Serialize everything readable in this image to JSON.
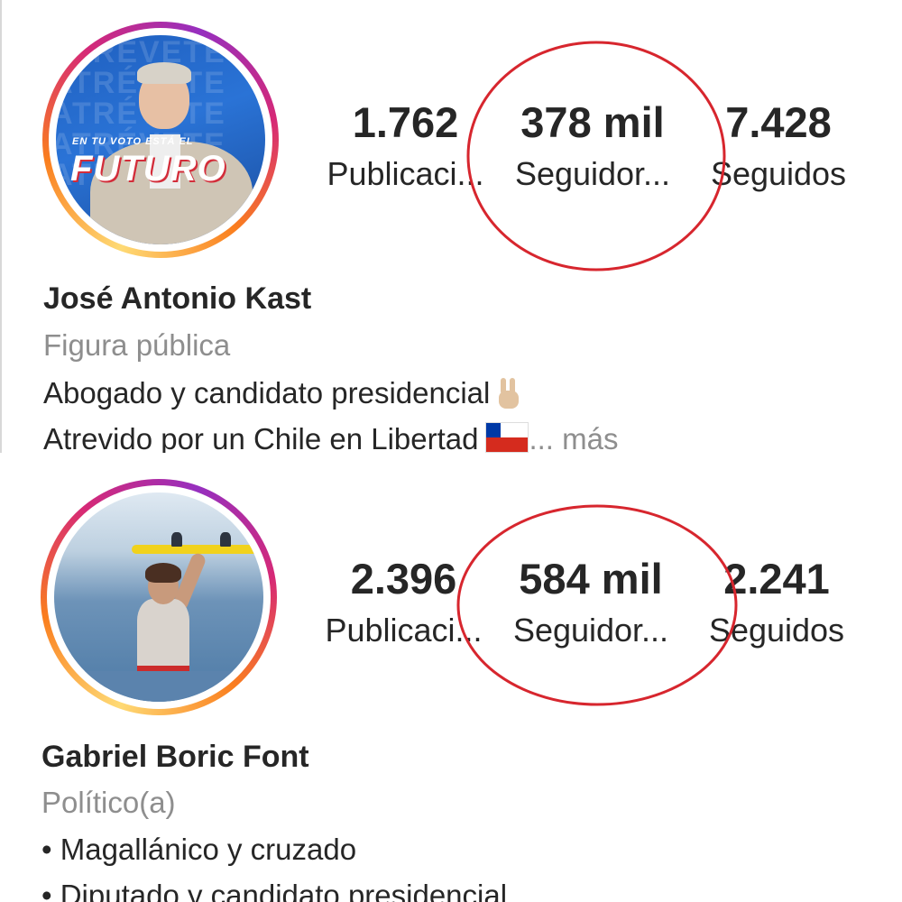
{
  "profiles": [
    {
      "stats": [
        {
          "value": "1.762",
          "label": "Publicaci..."
        },
        {
          "value": "378 mil",
          "label": "Seguidor..."
        },
        {
          "value": "7.428",
          "label": "Seguidos"
        }
      ],
      "name": "José Antonio Kast",
      "category": "Figura pública",
      "bio_line1": "Abogado y candidato presidencial",
      "bio_line2": "Atrevido por un Chile en Libertad",
      "more": "... más",
      "avatar_text_small": "EN TU VOTO ESTÁ EL",
      "avatar_text_big": "FUTURO",
      "avatar_bg_words": [
        "ATRÉVETE",
        "ATRÉVETE",
        "ATRÉVETE",
        "ATRÉVETE",
        "ATRÉVETE"
      ]
    },
    {
      "stats": [
        {
          "value": "2.396",
          "label": "Publicaci..."
        },
        {
          "value": "584 mil",
          "label": "Seguidor..."
        },
        {
          "value": "2.241",
          "label": "Seguidos"
        }
      ],
      "name": "Gabriel Boric Font",
      "category": "Político(a)",
      "bio_line1": "• Magallánico y cruzado",
      "bio_line2": "• Diputado y candidato presidencial"
    }
  ],
  "annotation_color": "#d7262e",
  "icons": [
    "peace-hand-emoji-icon",
    "chile-flag-emoji-icon"
  ]
}
